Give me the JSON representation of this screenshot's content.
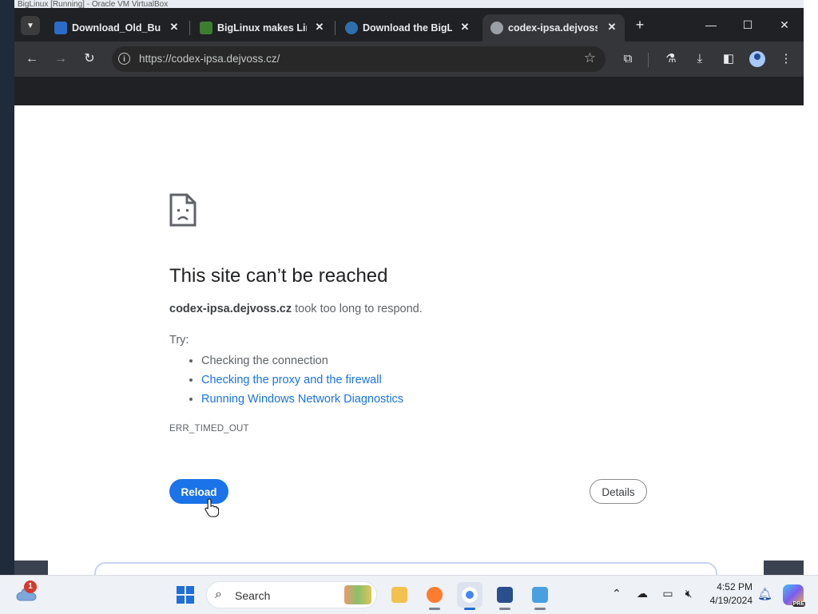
{
  "vm_window": {
    "title": "BigLinux [Running] - Oracle VM VirtualBox"
  },
  "tabs": [
    {
      "title": "Download_Old_Build",
      "close": "✕",
      "favicon_color": "#2a6cc8",
      "active": false
    },
    {
      "title": "BigLinux makes Linux",
      "close": "✕",
      "favicon_color": "#3d7d2f",
      "active": false
    },
    {
      "title": "Download the BigLinux",
      "close": "✕",
      "favicon_color": "#2f6fb0",
      "active": false
    },
    {
      "title": "codex-ipsa.dejvoss.cz",
      "close": "✕",
      "favicon_color": "#9aa0a6",
      "active": true
    }
  ],
  "toolbar": {
    "url": "https://codex-ipsa.dejvoss.cz/"
  },
  "error_page": {
    "title": "This site can’t be reached",
    "host": "codex-ipsa.dejvoss.cz",
    "description_suffix": " took too long to respond.",
    "try_label": "Try:",
    "suggestions": [
      {
        "text": "Checking the connection",
        "is_link": false
      },
      {
        "text": "Checking the proxy and the firewall",
        "is_link": true
      },
      {
        "text": "Running Windows Network Diagnostics",
        "is_link": true
      }
    ],
    "error_code": "ERR_TIMED_OUT",
    "reload_label": "Reload",
    "details_label": "Details"
  },
  "taskbar": {
    "notification_count": "1",
    "search_label": "Search",
    "time": "4:52 PM",
    "date": "4/19/2024",
    "copilot_badge": "PRE"
  },
  "colors": {
    "accent_blue": "#1a73e8",
    "chrome_dark": "#202124",
    "toolbar_dark": "#35363a"
  }
}
